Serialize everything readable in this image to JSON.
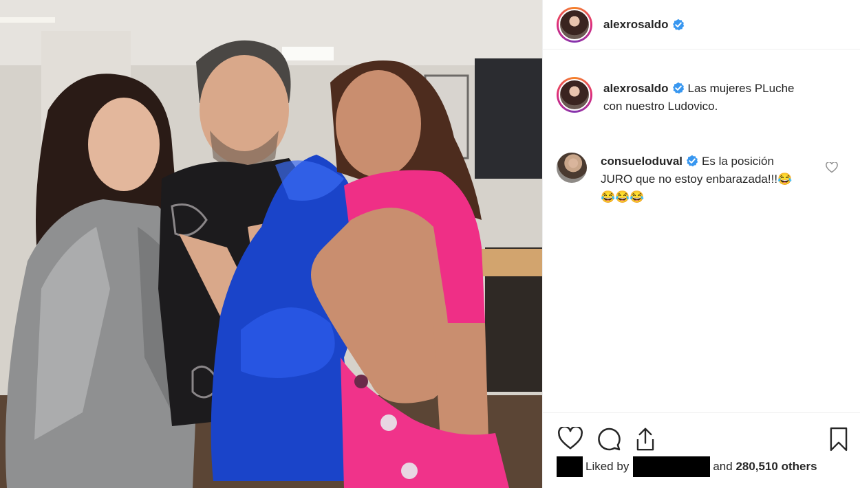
{
  "post": {
    "author": "alexrosaldo",
    "caption": "Las mujeres PLuche con nuestro Ludovico."
  },
  "comments": [
    {
      "username": "consueloduval",
      "text": "Es la posición JURO que no estoy enbarazada!!!😂😂😂😂"
    }
  ],
  "likes": {
    "prefix": "Liked by",
    "suffix_and": "and",
    "count": "280,510 others"
  },
  "icons": {
    "verified": "verified-badge-icon",
    "like": "heart-icon",
    "comment": "comment-bubble-icon",
    "share": "share-icon",
    "save": "bookmark-icon"
  },
  "colors": {
    "verified_blue": "#3897f0",
    "text": "#262626",
    "border": "#efefef"
  }
}
